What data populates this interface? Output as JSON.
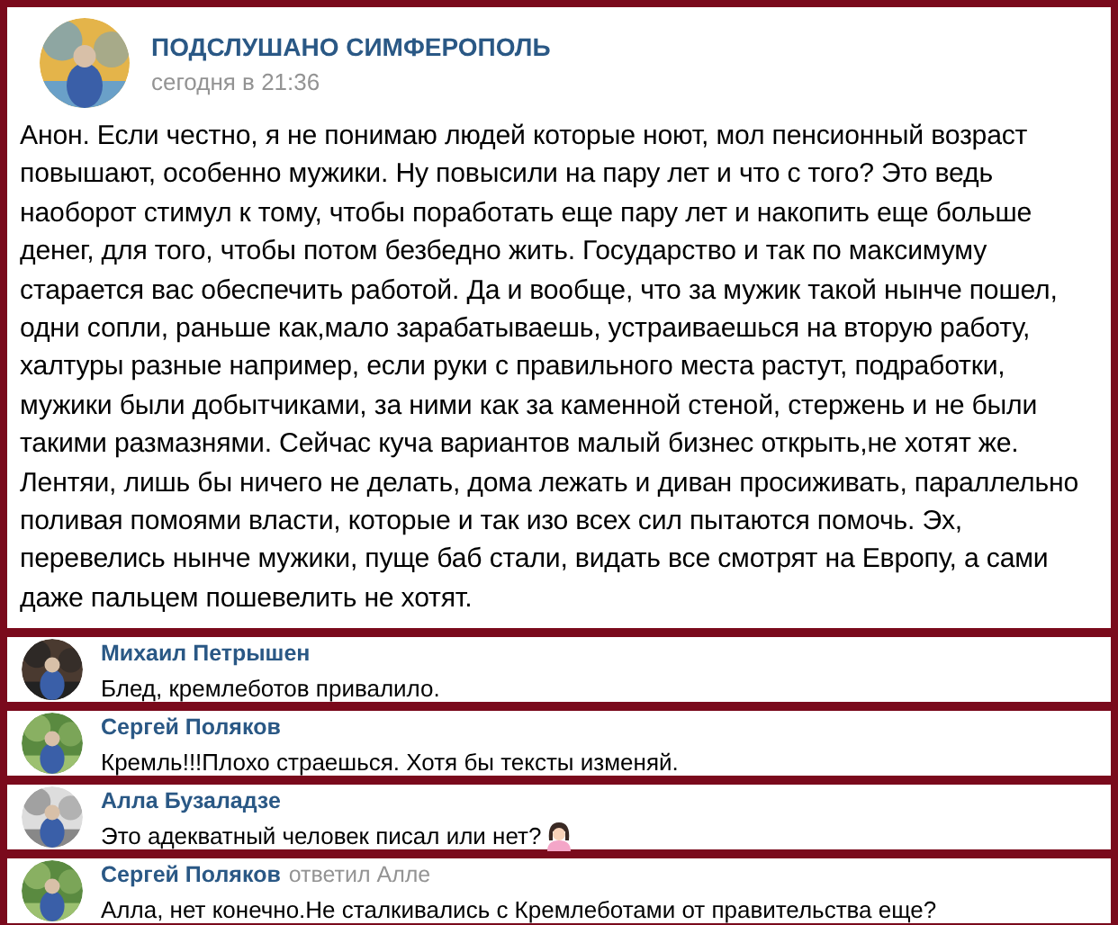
{
  "post": {
    "author": "ПОДСЛУШАНО СИМФЕРОПОЛЬ",
    "time": "сегодня в 21:36",
    "text": "Анон. Если честно, я не понимаю людей которые ноют, мол пенсионный возраст повышают, особенно мужики. Ну повысили на пару лет и что с того? Это ведь наоборот стимул к тому, чтобы поработать еще пару лет и накопить еще больше денег, для того, чтобы потом безбедно жить. Государство и так по максимуму старается вас обеспечить работой. Да и вообще, что за мужик такой нынче пошел, одни сопли, раньше как,мало зарабатываешь, устраиваешься на вторую работу, халтуры разные например, если руки с правильного места растут, подработки, мужики были добытчиками, за ними как за каменной стеной, стержень и не были такими размазнями. Сейчас куча вариантов малый бизнес открыть,не хотят же. Лентяи, лишь бы ничего не делать, дома лежать и диван просиживать, параллельно поливая помоями власти, которые и так изо всех сил пытаются помочь. Эх, перевелись нынче мужики, пуще баб стали, видать все смотрят на Европу, а сами даже пальцем пошевелить не хотят."
  },
  "comments": [
    {
      "author": "Михаил Петрышен",
      "text": "Блед, кремлеботов привалило.",
      "emoji": false
    },
    {
      "author": "Сергей Поляков",
      "text": "Кремль!!!Плохо страешься. Хотя бы тексты изменяй.",
      "emoji": false
    },
    {
      "author": "Алла Бузаладзе",
      "text": "Это адекватный человек писал или нет?",
      "emoji": true
    },
    {
      "author": "Сергей Поляков",
      "reply_to": "ответил Алле",
      "text": "Алла, нет конечно.Не сталкивались с Кремлеботами от правительства еще?",
      "emoji": false
    }
  ]
}
